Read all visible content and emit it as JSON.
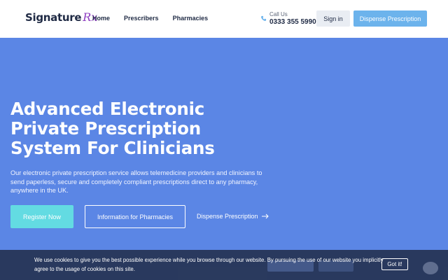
{
  "header": {
    "logo_text": "Signature",
    "logo_rx": "Rx",
    "nav": [
      {
        "label": "Home"
      },
      {
        "label": "Prescribers"
      },
      {
        "label": "Pharmacies"
      }
    ],
    "call_label": "Call Us",
    "call_number": "0333 355 5990",
    "signin_label": "Sign in",
    "dispense_label": "Dispense Prescription"
  },
  "hero": {
    "title_lines": [
      "Advanced Electronic",
      "Private Prescription",
      "System For Clinicians"
    ],
    "description": "Our electronic private prescription service allows telemedicine providers and clinicians to send paperless, secure and completely compliant prescriptions direct to any pharmacy, anywhere in the UK.",
    "register_label": "Register Now",
    "info_label": "Information for Pharmacies",
    "dispense_link": "Dispense Prescription"
  },
  "cookie": {
    "text": "We use cookies to give you the best possible experience while you browse through our website. By pursuing the use of our website you implicitly agree to the usage of cookies on this site.",
    "button_label": "Got it!"
  },
  "colors": {
    "hero_bg": "#5b86e5",
    "brand_dark": "#1f2a44",
    "accent_purple": "#8e3ec1",
    "dispense_blue": "#6cb3ec",
    "register_teal": "#63dbe2"
  },
  "icons": {
    "phone": "phone-icon",
    "arrow": "arrow-right-icon"
  }
}
